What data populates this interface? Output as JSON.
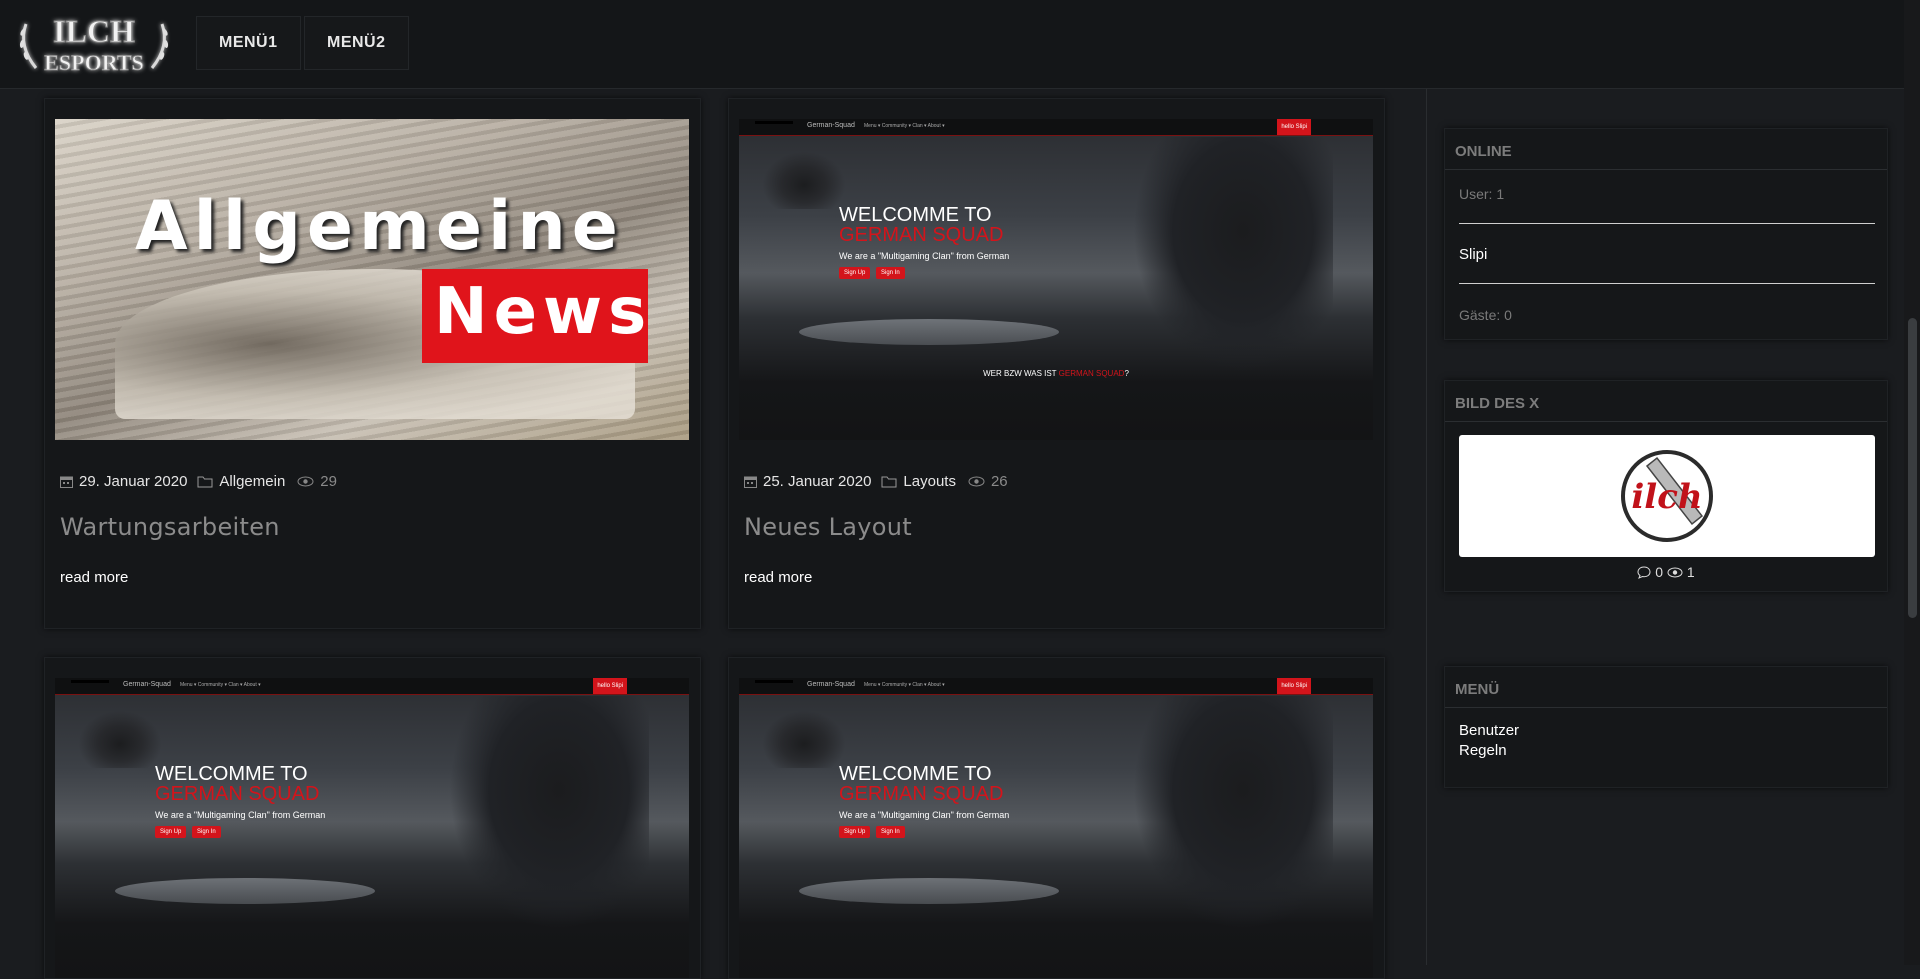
{
  "header": {
    "logo_text_top": "ILCH",
    "logo_text_bottom": "ESPORTS",
    "menu": [
      {
        "label": "MENÜ1"
      },
      {
        "label": "MENÜ2"
      }
    ]
  },
  "posts": [
    {
      "date": "29. Januar 2020",
      "category": "Allgemein",
      "views": "29",
      "title": "Wartungsarbeiten",
      "read_more": "read more",
      "image": {
        "line1": "Allgemeine",
        "line2": "News"
      }
    },
    {
      "date": "25. Januar 2020",
      "category": "Layouts",
      "views": "26",
      "title": "Neues Layout",
      "read_more": "read more",
      "image": {
        "brand": "German-Squad",
        "nav": "Menu ▾   Community ▾   Clan ▾   About ▾",
        "hello": "hello Slipi",
        "w1": "WELCOMME TO",
        "w2": "GERMAN SQUAD",
        "sub": "We are a \"Multigaming Clan\" from German",
        "btn1": "Sign Up",
        "btn2": "Sign In",
        "bottom_a": "WER BZW WAS IST ",
        "bottom_b": "GERMAN SQUAD",
        "bottom_c": "?"
      }
    },
    {
      "image": {
        "brand": "German-Squad",
        "nav": "Menu ▾   Community ▾   Clan ▾   About ▾",
        "hello": "hello Slipi",
        "w1": "WELCOMME TO",
        "w2": "GERMAN SQUAD",
        "sub": "We are a \"Multigaming Clan\" from German",
        "btn1": "Sign Up",
        "btn2": "Sign In"
      }
    },
    {
      "image": {
        "brand": "German-Squad",
        "nav": "Menu ▾   Community ▾   Clan ▾   About ▾",
        "hello": "hello Slipi",
        "w1": "WELCOMME TO",
        "w2": "GERMAN SQUAD",
        "sub": "We are a \"Multigaming Clan\" from German",
        "btn1": "Sign Up",
        "btn2": "Sign In"
      }
    }
  ],
  "sidebar": {
    "online": {
      "title": "ONLINE",
      "users": "User: 1",
      "user_name": "Slipi",
      "guests": "Gäste: 0"
    },
    "picture": {
      "title": "BILD DES X",
      "logo_text": "ilch",
      "comments": "0",
      "views": "1"
    },
    "menu": {
      "title": "MENÜ",
      "items": [
        {
          "label": "Benutzer"
        },
        {
          "label": "Regeln"
        }
      ]
    }
  },
  "icons": [
    "calendar-icon",
    "folder-icon",
    "eye-icon",
    "comment-icon"
  ],
  "colors": {
    "accent_red": "#d3141b",
    "background": "#1a1c1f",
    "card": "#151719"
  }
}
